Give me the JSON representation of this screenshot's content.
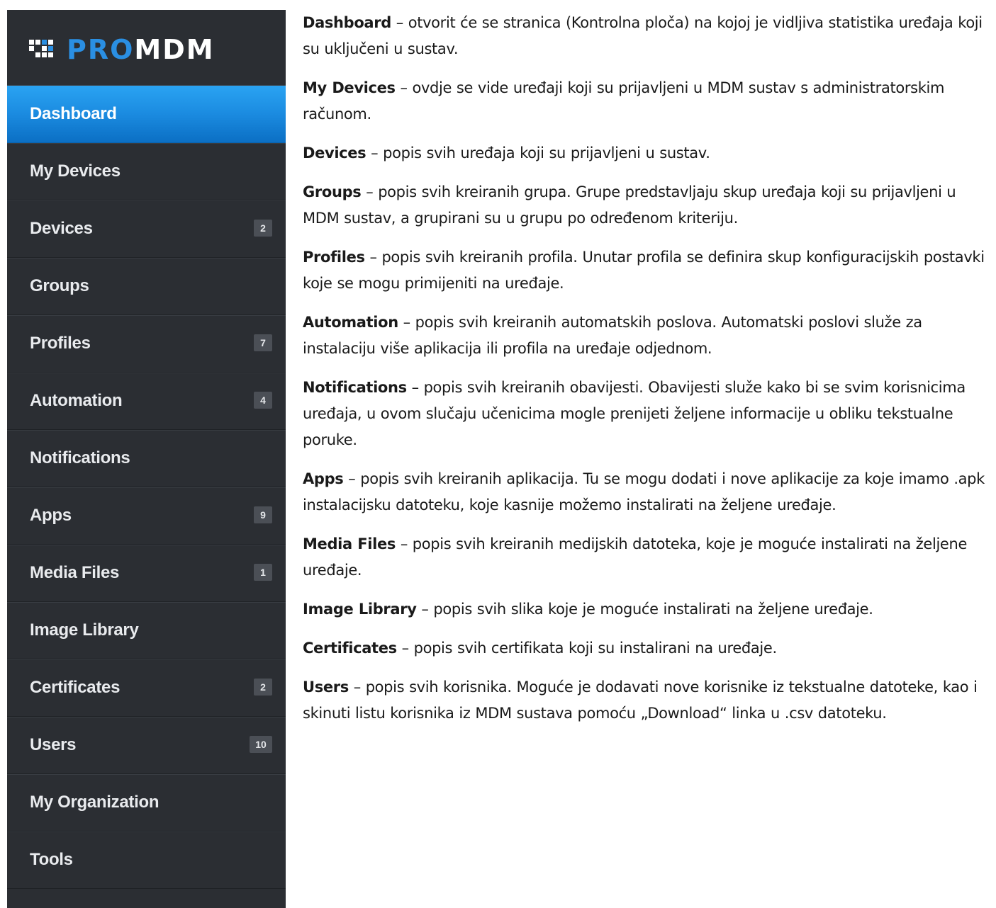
{
  "logo": {
    "pro": "PRO",
    "mdm": "MDM",
    "accent": "#2a8fe3"
  },
  "sidebar": {
    "items": [
      {
        "label": "Dashboard",
        "badge": "",
        "active": true
      },
      {
        "label": "My Devices",
        "badge": ""
      },
      {
        "label": "Devices",
        "badge": "2"
      },
      {
        "label": "Groups",
        "badge": ""
      },
      {
        "label": "Profiles",
        "badge": "7"
      },
      {
        "label": "Automation",
        "badge": "4"
      },
      {
        "label": "Notifications",
        "badge": ""
      },
      {
        "label": "Apps",
        "badge": "9"
      },
      {
        "label": "Media Files",
        "badge": "1"
      },
      {
        "label": "Image Library",
        "badge": ""
      },
      {
        "label": "Certificates",
        "badge": "2"
      },
      {
        "label": "Users",
        "badge": "10"
      },
      {
        "label": "My Organization",
        "badge": ""
      },
      {
        "label": "Tools",
        "badge": ""
      }
    ]
  },
  "descriptions": [
    {
      "term": "Dashboard",
      "text": " – otvorit će se stranica (Kontrolna ploča) na kojoj je vidljiva statistika uređaja koji su uključeni u sustav."
    },
    {
      "term": "My Devices",
      "text": " – ovdje se vide uređaji koji su prijavljeni u MDM sustav s administratorskim računom."
    },
    {
      "term": "Devices",
      "text": " – popis svih uređaja koji su prijavljeni u sustav."
    },
    {
      "term": "Groups",
      "text": " – popis svih kreiranih grupa. Grupe predstavljaju skup uređaja koji su prijavljeni u MDM sustav, a grupirani su u grupu po određenom kriteriju."
    },
    {
      "term": "Profiles",
      "text": " – popis svih kreiranih profila. Unutar profila se definira skup konfiguracijskih postavki koje se mogu primijeniti na uređaje."
    },
    {
      "term": "Automation",
      "text": " – popis svih kreiranih automatskih poslova. Automatski poslovi služe za instalaciju više aplikacija ili profila na uređaje odjednom."
    },
    {
      "term": "Notifications",
      "text": " – popis svih kreiranih obavijesti. Obavijesti služe kako bi se svim korisnicima uređaja, u ovom slučaju učenicima mogle prenijeti željene informacije u obliku tekstualne poruke."
    },
    {
      "term": "Apps",
      "text": " – popis svih kreiranih aplikacija. Tu se mogu dodati i nove aplikacije za koje imamo .apk instalacijsku datoteku, koje kasnije možemo instalirati na željene uređaje."
    },
    {
      "term": "Media Files",
      "text": " – popis svih kreiranih medijskih datoteka, koje je moguće instalirati na željene uređaje."
    },
    {
      "term": "Image Library",
      "text": " – popis svih slika koje je moguće instalirati na željene uređaje."
    },
    {
      "term": "Certificates",
      "text": " – popis svih certifikata koji su instalirani na uređaje."
    },
    {
      "term": "Users",
      "text": " – popis svih korisnika. Moguće je dodavati nove korisnike iz tekstualne datoteke, kao i skinuti listu korisnika iz MDM sustava pomoću „Download“ linka u .csv datoteku."
    }
  ]
}
